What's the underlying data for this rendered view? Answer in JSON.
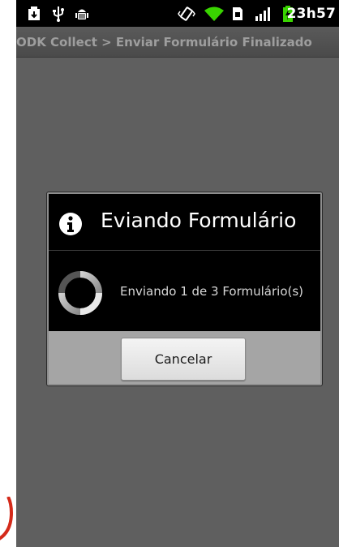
{
  "status_bar": {
    "icons": [
      "download-icon",
      "usb-icon",
      "android-debug-icon",
      "vibrate-icon",
      "wifi-icon",
      "sim-icon",
      "signal-icon",
      "battery-charging-icon"
    ],
    "clock": "23h57"
  },
  "title_bar": {
    "title": "ODK Collect > Enviar Formulário Finalizado"
  },
  "dialog": {
    "icon": "info-icon",
    "title": "Eviando Formulário",
    "message": "Enviando 1 de 3 Formulário(s)",
    "cancel_label": "Cancelar"
  },
  "colors": {
    "background": "#5f5f5f",
    "dialog": "#000000",
    "footer": "#a5a5a5",
    "battery": "#39d400",
    "wifi": "#39d400"
  }
}
